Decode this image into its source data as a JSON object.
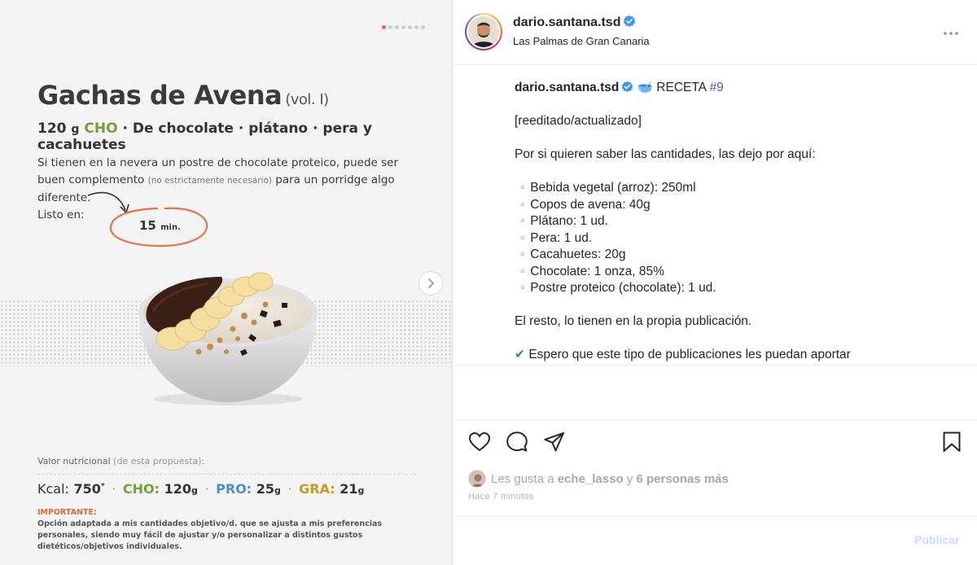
{
  "recipe_card": {
    "title": "Gachas de Avena",
    "title_vol": "(vol. I)",
    "subtitle": {
      "carbs_amount": "120",
      "carbs_unit": "g",
      "carbs_label": "CHO",
      "flavor": "· De chocolate · plátano · pera y cacahuetes"
    },
    "intro": {
      "part1": "Si tienen en la nevera un postre de chocolate proteico, puede ser buen complemento ",
      "note": "(no estrictamente necesario)",
      "part2": " para un porridge algo diferente.",
      "ready_label": "Listo en:"
    },
    "time": {
      "value": "15",
      "unit": "min."
    },
    "nutrition": {
      "heading": "Valor nutricional",
      "heading_note": "(de esta propuesta):",
      "kcal_label": "Kcal:",
      "kcal_value": "750",
      "kcal_mark": "*",
      "cho_label": "CHO:",
      "cho_value": "120",
      "pro_label": "PRO:",
      "pro_value": "25",
      "gra_label": "GRA:",
      "gra_value": "21",
      "unit": "g",
      "separator": "·"
    },
    "important_title": "IMPORTANTE:",
    "important_text": "Opción adaptada a mis cantidades objetivo/d. que se ajusta a mis preferencias personales, siendo muy fácil de ajustar y/o personalizar a distintos gustos dietéticos/objetivos individuales.",
    "carousel": {
      "total": 7,
      "active": 0
    }
  },
  "post": {
    "username": "dario.santana.tsd",
    "location": "Las Palmas de Gran Canaria",
    "caption": {
      "username": "dario.santana.tsd",
      "emoji": "🥣",
      "label": "RECETA",
      "hashtag": "#9",
      "edited": "[reeditado/actualizado]",
      "intro": "Por si quieren saber las cantidades, las dejo por aquí:",
      "ingredients": [
        "▫️Bebida vegetal (arroz): 250ml",
        "▫️Copos de avena: 40g",
        "▫️Plátano: 1 ud.",
        "▫️Pera: 1 ud.",
        "▫️Cacahuetes: 20g",
        "▫️Chocolate: 1 onza, 85%",
        "▫️Postre proteico (chocolate): 1 ud."
      ],
      "rest": "El resto, lo tienen en la propia publicación.",
      "check_emoji": "✔",
      "closing": "Espero que este tipo de publicaciones les puedan aportar"
    },
    "likes": {
      "prefix": "Les gusta a",
      "user": "eche_lasso",
      "connector": "y",
      "others": "6 personas más"
    },
    "timestamp": "Hace 7 minutos",
    "publish_label": "Publicar"
  },
  "colors": {
    "accent_orange": "#e8743b",
    "cho_green": "#6fa23b",
    "pro_blue": "#4c8fcf",
    "gra_gold": "#c99a16",
    "verified_blue": "#3897f0",
    "hashtag_blue": "#4c5eb5"
  }
}
